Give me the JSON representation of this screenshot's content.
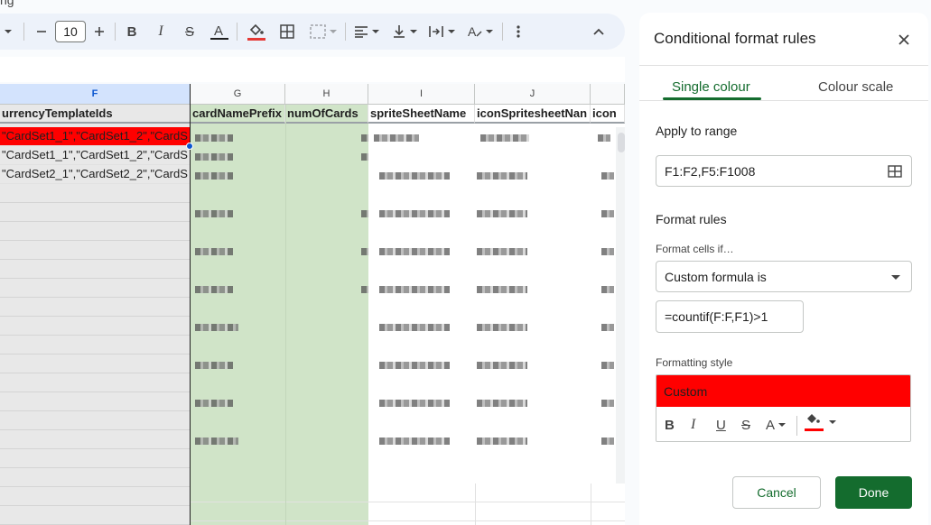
{
  "title_fragment": "ng",
  "toolbar": {
    "font_size": "10",
    "icons": [
      "chevron-down",
      "minus",
      "plus",
      "bold",
      "italic",
      "strikethrough",
      "text-color",
      "fill-color",
      "borders",
      "merge-cells",
      "align-left",
      "valign-bottom",
      "text-wrap",
      "text-rotation",
      "more-vert",
      "collapse-up"
    ]
  },
  "grid": {
    "columns": [
      {
        "letter": "F",
        "selected": true
      },
      {
        "letter": "G",
        "selected": false
      },
      {
        "letter": "H",
        "selected": false
      },
      {
        "letter": "I",
        "selected": false
      },
      {
        "letter": "J",
        "selected": false
      },
      {
        "letter": "",
        "selected": false
      }
    ],
    "header_row": [
      "urrencyTemplateIds",
      "cardNamePrefix",
      "numOfCards",
      "spriteSheetName",
      "iconSpritesheetNan",
      "icon"
    ],
    "f_values": [
      "\"CardSet1_1\",\"CardSet1_2\",\"CardS",
      "\"CardSet1_1\",\"CardSet1_2\",\"CardS",
      "\"CardSet2_1\",\"CardSet2_2\",\"CardS"
    ],
    "highlight_color": "#ff0000",
    "range_color": "#d0e4c8"
  },
  "panel": {
    "title": "Conditional format rules",
    "tabs": [
      "Single colour",
      "Colour scale"
    ],
    "apply_label": "Apply to range",
    "range_value": "F1:F2,F5:F1008",
    "format_rules_label": "Format rules",
    "format_cells_if_label": "Format cells if…",
    "condition": "Custom formula is",
    "formula": "=countif(F:F,F1)>1",
    "formatting_style_label": "Formatting style",
    "style_preview": "Custom",
    "style_tools": [
      "B",
      "I",
      "U",
      "S",
      "A"
    ],
    "style_fill_color": "#ff0000",
    "cancel_label": "Cancel",
    "done_label": "Done",
    "accent_color": "#146c2e"
  }
}
